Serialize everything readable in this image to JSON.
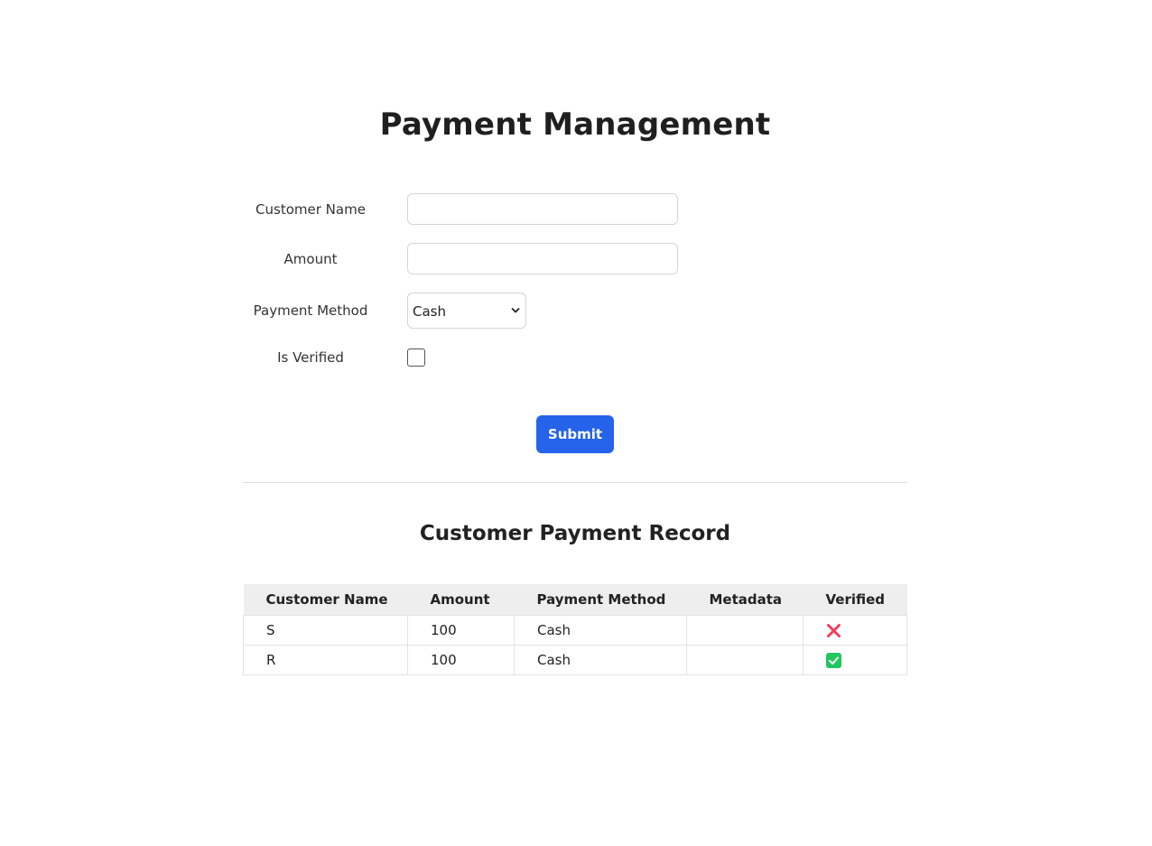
{
  "page": {
    "title": "Payment Management"
  },
  "form": {
    "customer_name_label": "Customer Name",
    "customer_name_value": "",
    "amount_label": "Amount",
    "amount_value": "",
    "payment_method_label": "Payment Method",
    "payment_method_selected": "Cash",
    "is_verified_label": "Is Verified",
    "is_verified_checked": false,
    "submit_label": "Submit"
  },
  "records": {
    "title": "Customer Payment Record",
    "columns": [
      "Customer Name",
      "Amount",
      "Payment Method",
      "Metadata",
      "Verified"
    ],
    "rows": [
      {
        "customer_name": "S",
        "amount": "100",
        "payment_method": "Cash",
        "metadata": "",
        "verified": false,
        "verified_icon": "cross-mark-icon"
      },
      {
        "customer_name": "R",
        "amount": "100",
        "payment_method": "Cash",
        "metadata": "",
        "verified": true,
        "verified_icon": "check-mark-icon"
      }
    ]
  },
  "colors": {
    "submit_button": "#2563eb",
    "verified_true": "#22c55e",
    "verified_false": "#f43f5e",
    "table_header_bg": "#eeeeee"
  }
}
